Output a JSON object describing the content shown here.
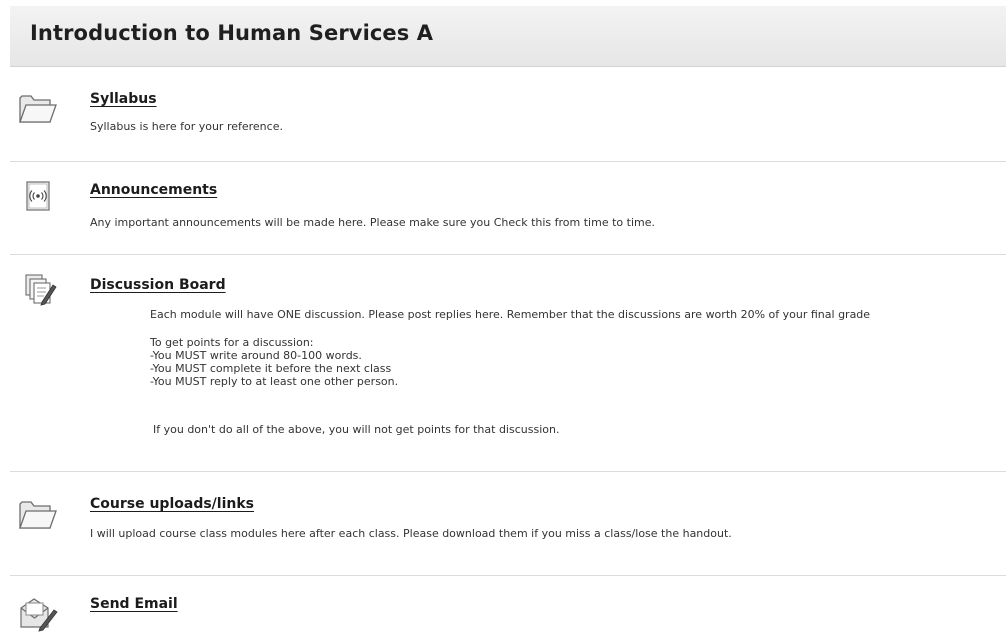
{
  "page": {
    "title": "Introduction to Human Services A"
  },
  "items": [
    {
      "title": "Syllabus",
      "icon": "folder-icon",
      "description": "Syllabus is here for your reference."
    },
    {
      "title": "Announcements",
      "icon": "announcement-icon",
      "description": "Any important announcements will be made here. Please make sure you Check this from time to time."
    },
    {
      "title": "Discussion Board",
      "icon": "discussion-board-icon",
      "intro": "Each module will have ONE discussion. Please post replies here. Remember that the discussions are worth 20% of your final grade",
      "rules_heading": "To get points for a discussion:",
      "rules": [
        "-You MUST write around 80-100 words.",
        "-You MUST complete it before the next class",
        "-You MUST reply to at least one other person."
      ],
      "footer": "If you don't do all of the above, you will not get points for that discussion."
    },
    {
      "title": "Course uploads/links",
      "icon": "folder-icon",
      "description": "I will upload course class modules here after each class. Please download them if you miss a class/lose the handout."
    },
    {
      "title": "Send Email",
      "icon": "email-icon"
    }
  ]
}
